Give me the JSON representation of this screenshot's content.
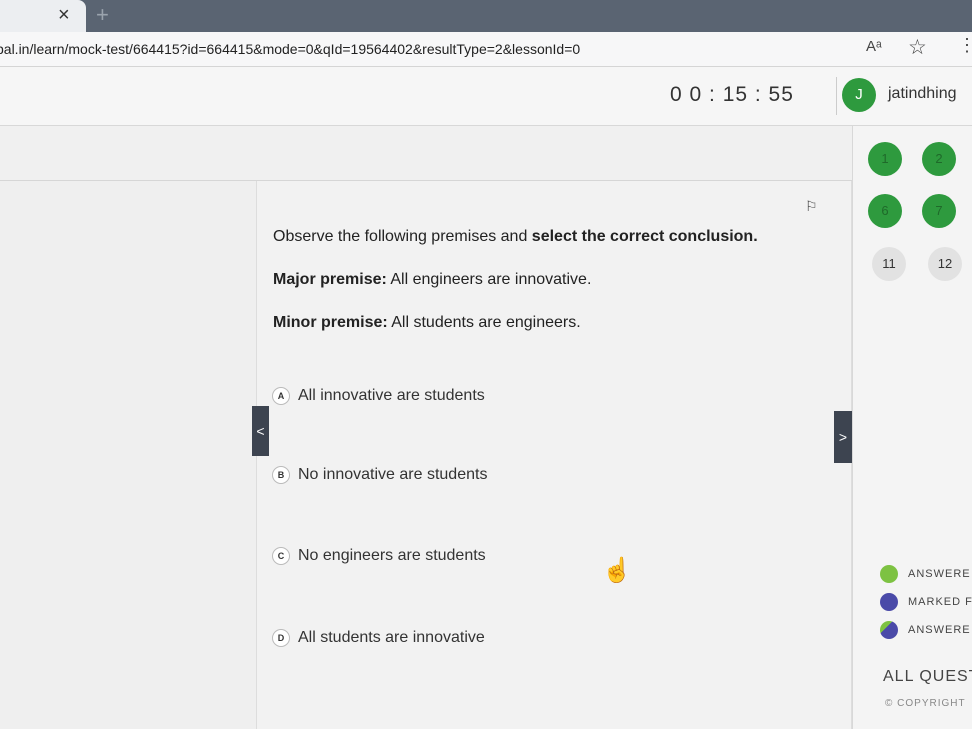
{
  "browser": {
    "tab_close": "×",
    "new_tab": "+",
    "url": "bal.in/learn/mock-test/664415?id=664415&mode=0&qId=19564402&resultType=2&lessonId=0",
    "read_aloud": "Aᵃ",
    "favorite": "☆",
    "more": "⋮"
  },
  "header": {
    "timer": "0 0 : 15 : 55",
    "avatar_initial": "J",
    "username": "jatindhing"
  },
  "question": {
    "flag_icon": "⚐",
    "prompt_prefix": "Observe the following premises and ",
    "prompt_bold": "select the correct conclusion.",
    "major_label": "Major premise:",
    "major_text": " All engineers are innovative.",
    "minor_label": "Minor premise:",
    "minor_text": " All students are engineers.",
    "options": [
      {
        "letter": "A",
        "text": "All innovative are students"
      },
      {
        "letter": "B",
        "text": "No innovative are students"
      },
      {
        "letter": "C",
        "text": "No engineers are students"
      },
      {
        "letter": "D",
        "text": "All students are innovative"
      }
    ]
  },
  "nav": {
    "prev": "<",
    "next": ">"
  },
  "palette": {
    "numbers": [
      "1",
      "2",
      "6",
      "7",
      "11",
      "12"
    ]
  },
  "legend": [
    {
      "label": "ANSWERE",
      "color": "#7dc242"
    },
    {
      "label": "MARKED F",
      "color": "#4a4aa8"
    },
    {
      "label": "ANSWERE",
      "color": "#4a4aa8"
    }
  ],
  "footer": {
    "all_questions": "ALL QUEST",
    "copyright": "© COPYRIGHT"
  },
  "colors": {
    "answered": "#2e9a3e",
    "nav_button": "#3d4450"
  }
}
